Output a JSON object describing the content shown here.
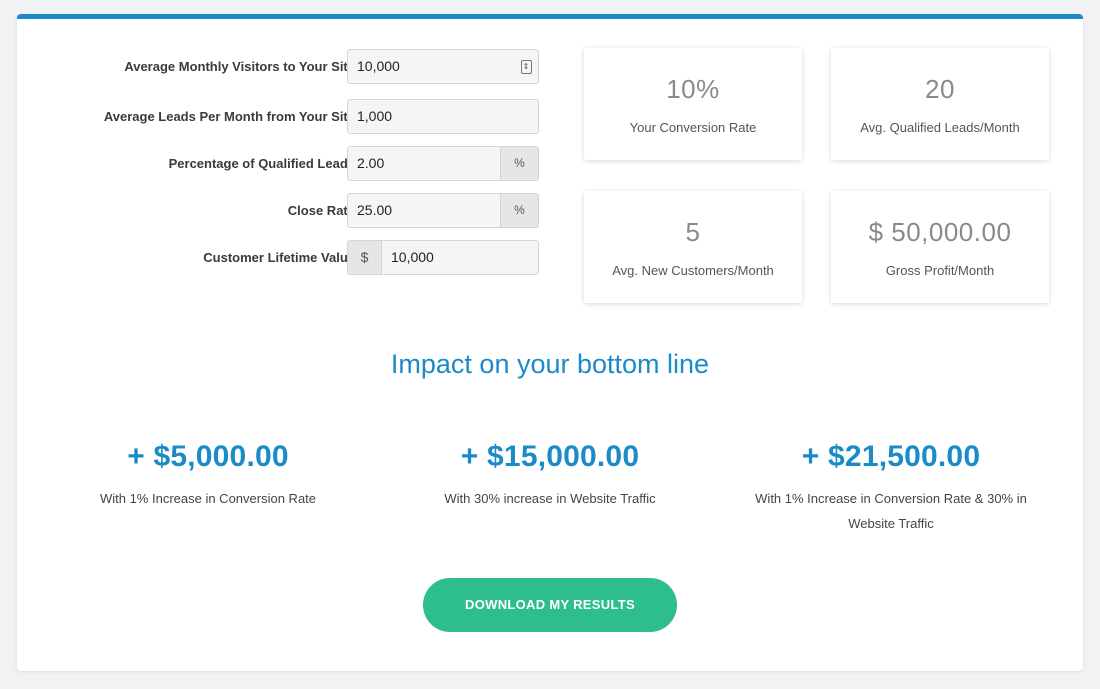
{
  "form": {
    "fields": [
      {
        "label": "Average Monthly Visitors to Your Site",
        "value": "10,000",
        "addon_right": "",
        "addon_left": "",
        "icon": "stepper-icon"
      },
      {
        "label": "Average Leads Per Month from Your Site",
        "value": "1,000",
        "addon_right": "",
        "addon_left": ""
      },
      {
        "label": "Percentage of Qualified Leads",
        "value": "2.00",
        "addon_right": "%",
        "addon_left": ""
      },
      {
        "label": "Close Rate",
        "value": "25.00",
        "addon_right": "%",
        "addon_left": ""
      },
      {
        "label": "Customer Lifetime Value",
        "value": "10,000",
        "addon_right": "",
        "addon_left": "$"
      }
    ]
  },
  "stats": [
    {
      "value": "10%",
      "label": "Your Conversion Rate"
    },
    {
      "value": "20",
      "label": "Avg. Qualified Leads/Month"
    },
    {
      "value": "5",
      "label": "Avg. New Customers/Month"
    },
    {
      "value": "$ 50,000.00",
      "label": "Gross Profit/Month"
    }
  ],
  "impact": {
    "title": "Impact on your bottom line",
    "items": [
      {
        "amount": "+ $5,000.00",
        "desc": "With 1% Increase in Conversion Rate"
      },
      {
        "amount": "+ $15,000.00",
        "desc": "With 30% increase in Website Traffic"
      },
      {
        "amount": "+ $21,500.00",
        "desc": "With 1% Increase in Conversion Rate & 30% in Website Traffic"
      }
    ]
  },
  "download_label": "DOWNLOAD MY RESULTS",
  "colors": {
    "accent": "#1b8bc7",
    "button": "#2dbe8c"
  }
}
